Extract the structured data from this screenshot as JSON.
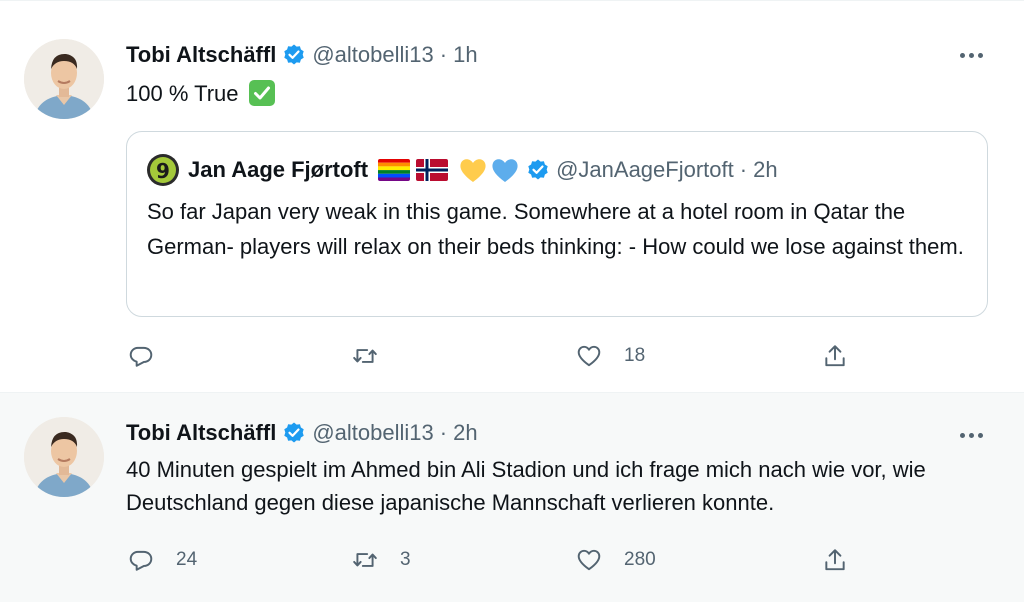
{
  "tweets": [
    {
      "author_name": "Tobi Altschäffl",
      "handle": "@altobelli13",
      "time": "1h",
      "text": "100 % True",
      "text_emoji": "white-check-mark",
      "quote": {
        "author_name": "Jan Aage Fjørtoft",
        "avatar_glyph": "9",
        "name_emojis": [
          "rainbow-flag",
          "norway-flag",
          "yellow-heart",
          "blue-heart"
        ],
        "handle": "@JanAageFjortoft",
        "time": "2h",
        "text": "So far Japan very weak in this game. Somewhere at a hotel room in Qatar the German- players will relax on their beds thinking: - How could we lose against them."
      },
      "actions": {
        "replies": "",
        "retweets": "",
        "likes": "18"
      }
    },
    {
      "author_name": "Tobi Altschäffl",
      "handle": "@altobelli13",
      "time": "2h",
      "text": "40 Minuten gespielt im Ahmed bin Ali Stadion und ich frage mich nach wie vor, wie Deutschland gegen diese japanische Mannschaft verlieren konnte.",
      "actions": {
        "replies": "24",
        "retweets": "3",
        "likes": "280"
      }
    }
  ],
  "separator": "·",
  "icons": {
    "verified": "verified-badge-icon",
    "more": "more-options-icon",
    "reply": "reply-icon",
    "retweet": "retweet-icon",
    "like": "like-icon",
    "share": "share-icon"
  },
  "colors": {
    "verified_blue": "#1d9bf0",
    "text_primary": "#0f1419",
    "text_secondary": "#536471",
    "border": "#cfd9de",
    "second_tweet_bg": "#f7f9f9"
  }
}
